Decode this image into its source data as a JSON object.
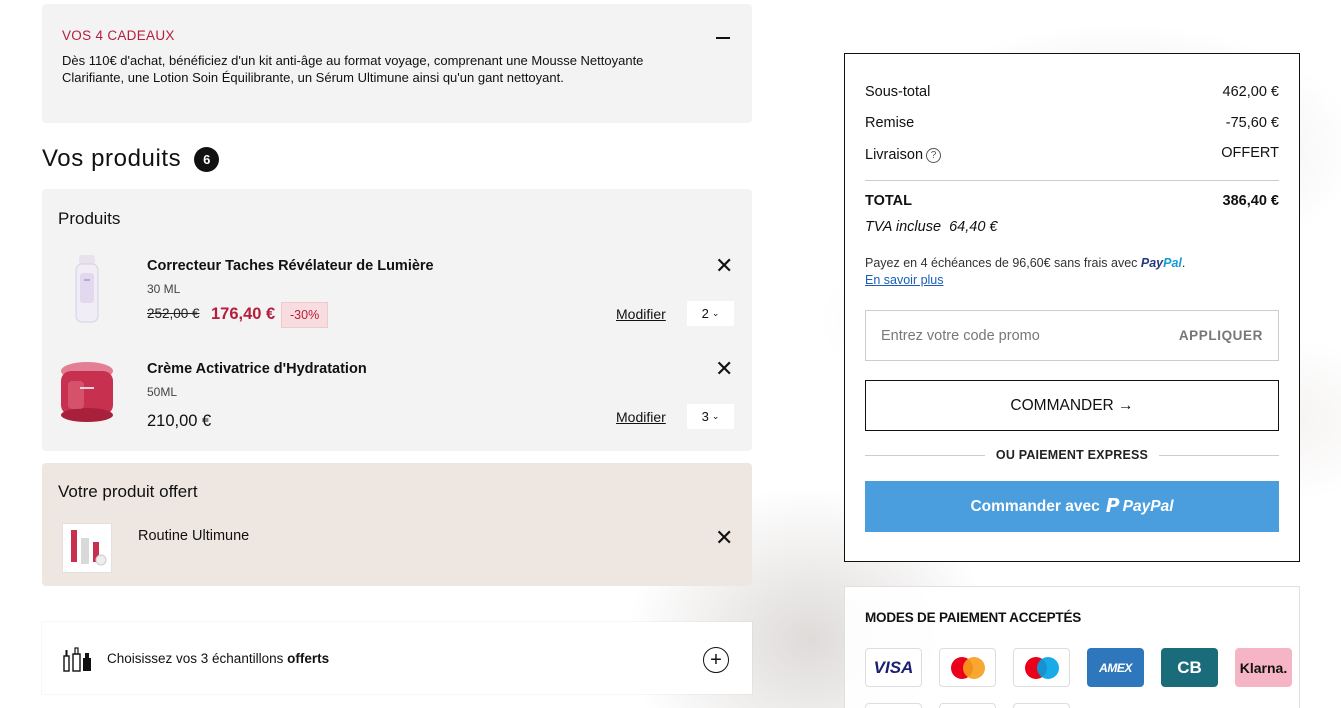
{
  "gifts": {
    "title": "VOS 4 CADEAUX",
    "text": "Dès 110€ d'achat, bénéficiez d'un kit anti-âge au format voyage, comprenant une Mousse Nettoyante Clarifiante, une Lotion Soin Équilibrante, un Sérum Ultimune ainsi qu'un gant nettoyant."
  },
  "products_section": {
    "title": "Vos produits",
    "count": "6"
  },
  "products_box": {
    "title": "Produits",
    "items": [
      {
        "name": "Correcteur Taches Révélateur de Lumière",
        "size": "30 ML",
        "old_price": "252,00 €",
        "price": "176,40 €",
        "discount": "-30%",
        "modify": "Modifier",
        "qty": "2"
      },
      {
        "name": "Crème Activatrice d'Hydratation",
        "size": "50ML",
        "price": "210,00 €",
        "modify": "Modifier",
        "qty": "3"
      }
    ]
  },
  "gift_product": {
    "title": "Votre produit offert",
    "name": "Routine Ultimune"
  },
  "samples": {
    "text": "Choisissez vos 3 échantillons ",
    "bold": "offerts"
  },
  "summary": {
    "subtotal_label": "Sous-total",
    "subtotal": "462,00 €",
    "discount_label": "Remise",
    "discount": "-75,60 €",
    "shipping_label": "Livraison",
    "shipping": "OFFERT",
    "total_label": "TOTAL",
    "total": "386,40 €",
    "tva_label": "TVA incluse",
    "tva": "64,40 €",
    "paypal_note": "Payez en 4 échéances de 96,60€ sans frais avec ",
    "paypal_brand_1": "Pay",
    "paypal_brand_2": "Pal",
    "learn_more": "En savoir plus",
    "promo_placeholder": "Entrez votre code promo",
    "apply": "APPLIQUER",
    "checkout": "COMMANDER →",
    "express": "OU PAIEMENT EXPRESS",
    "paypal_button": "Commander avec",
    "paypal_button_logo": "PayPal"
  },
  "payment": {
    "title": "MODES DE PAIEMENT ACCEPTÉS",
    "cards": [
      "VISA",
      "Mastercard",
      "Maestro",
      "AMEX",
      "CB",
      "Klarna."
    ]
  }
}
